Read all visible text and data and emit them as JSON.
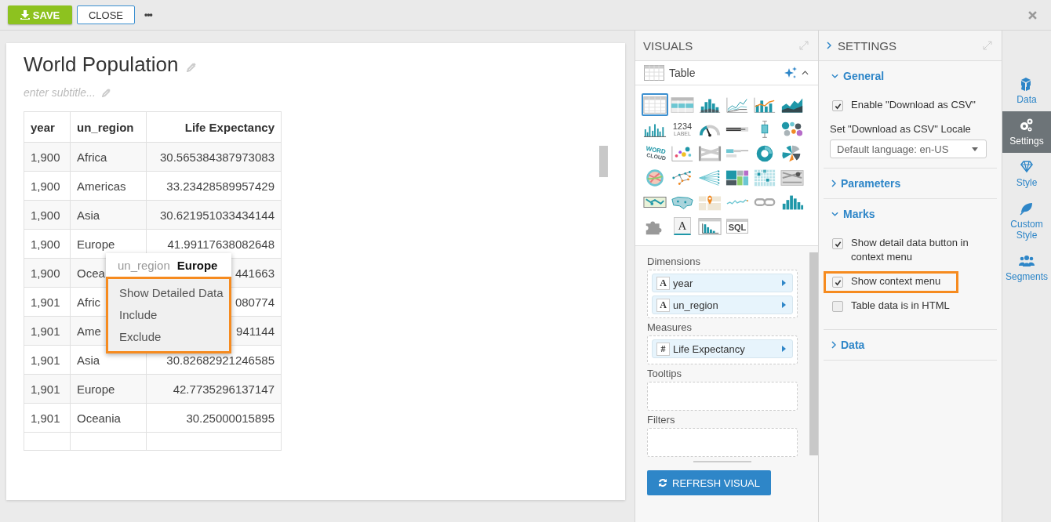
{
  "toolbar": {
    "save": "SAVE",
    "close": "CLOSE",
    "more": "•••"
  },
  "visual": {
    "title": "World Population",
    "subtitle_placeholder": "enter subtitle...",
    "table": {
      "columns": [
        "year",
        "un_region",
        "Life Expectancy"
      ],
      "rows": [
        [
          "1,900",
          "Africa",
          "30.565384387973083"
        ],
        [
          "1,900",
          "Americas",
          "33.23428589957429"
        ],
        [
          "1,900",
          "Asia",
          "30.621951033434144"
        ],
        [
          "1,900",
          "Europe",
          "41.99117638082648"
        ],
        [
          "1,900",
          "Ocea",
          "441663"
        ],
        [
          "1,901",
          "Afric",
          "080774"
        ],
        [
          "1,901",
          "Ame",
          "941144"
        ],
        [
          "1,901",
          "Asia",
          "30.82682921246585"
        ],
        [
          "1,901",
          "Europe",
          "42.7735296137147"
        ],
        [
          "1,901",
          "Oceania",
          "30.25000015895"
        ]
      ]
    },
    "context_menu": {
      "field": "un_region",
      "value": "Europe",
      "highlighted": true,
      "items": [
        "Show Detailed Data",
        "Include",
        "Exclude"
      ]
    }
  },
  "visuals_panel": {
    "title": "VISUALS",
    "current": "Table",
    "types": [
      {
        "kind": "table",
        "selected": true
      },
      {
        "kind": "crosstab",
        "selected": false
      },
      {
        "kind": "stacked-bars",
        "selected": false
      },
      {
        "kind": "lines",
        "selected": false
      },
      {
        "kind": "combo",
        "selected": false
      },
      {
        "kind": "areas",
        "selected": false
      },
      {
        "kind": "bars",
        "selected": false
      },
      {
        "kind": "kpi",
        "selected": false,
        "texts": [
          "1234",
          "LABEL"
        ]
      },
      {
        "kind": "gauge",
        "selected": false
      },
      {
        "kind": "bullet",
        "selected": false
      },
      {
        "kind": "boxplot",
        "selected": false
      },
      {
        "kind": "bubbles",
        "selected": false
      },
      {
        "kind": "wordcloud",
        "selected": false,
        "texts": [
          "WORD",
          "CLOUD"
        ]
      },
      {
        "kind": "scatter",
        "selected": false
      },
      {
        "kind": "sankey",
        "selected": false
      },
      {
        "kind": "funnel",
        "selected": false
      },
      {
        "kind": "donut",
        "selected": false
      },
      {
        "kind": "radial",
        "selected": false
      },
      {
        "kind": "chord",
        "selected": false
      },
      {
        "kind": "network",
        "selected": false
      },
      {
        "kind": "dendrogram",
        "selected": false
      },
      {
        "kind": "treemap",
        "selected": false
      },
      {
        "kind": "heatmap",
        "selected": false
      },
      {
        "kind": "corrflow",
        "selected": false
      },
      {
        "kind": "map",
        "selected": false
      },
      {
        "kind": "usmap",
        "selected": false
      },
      {
        "kind": "pinmap",
        "selected": false
      },
      {
        "kind": "sparkline",
        "selected": false
      },
      {
        "kind": "link",
        "selected": false
      },
      {
        "kind": "histogram",
        "selected": false
      },
      {
        "kind": "extension",
        "selected": false
      },
      {
        "kind": "richtext",
        "selected": false,
        "texts": [
          "A"
        ]
      },
      {
        "kind": "tablehist",
        "selected": false
      },
      {
        "kind": "sql",
        "selected": false,
        "texts": [
          "SQL"
        ]
      }
    ],
    "shelves": [
      {
        "label": "Dimensions",
        "fields": [
          {
            "badge": "A",
            "name": "year"
          },
          {
            "badge": "A",
            "name": "un_region"
          }
        ]
      },
      {
        "label": "Measures",
        "fields": [
          {
            "badge": "#",
            "name": "Life Expectancy"
          }
        ]
      },
      {
        "label": "Tooltips"
      },
      {
        "label": "Filters"
      }
    ],
    "refresh": "REFRESH VISUAL"
  },
  "settings_panel": {
    "title": "SETTINGS",
    "sections": [
      {
        "label": "General",
        "expanded": true,
        "items": [
          {
            "kind": "checkbox",
            "label": "Enable \"Download as CSV\"",
            "checked": true,
            "highlighted": false
          },
          {
            "kind": "select",
            "label": "Set \"Download as CSV\" Locale",
            "value": "Default language: en-US"
          }
        ]
      },
      {
        "label": "Parameters",
        "expanded": false
      },
      {
        "label": "Marks",
        "expanded": true,
        "items": [
          {
            "kind": "checkbox",
            "label": "Show detail data button in context menu",
            "checked": true,
            "highlighted": false
          },
          {
            "kind": "checkbox",
            "label": "Show context menu",
            "checked": true,
            "highlighted": true
          },
          {
            "kind": "checkbox",
            "label": "Table data is in HTML",
            "checked": false,
            "highlighted": false
          }
        ]
      },
      {
        "label": "Data",
        "expanded": false
      }
    ]
  },
  "side_nav": [
    {
      "label": "Data",
      "selected": false
    },
    {
      "label": "Settings",
      "selected": true
    },
    {
      "label": "Style",
      "selected": false
    },
    {
      "label": "Custom Style",
      "selected": false
    },
    {
      "label": "Segments",
      "selected": false
    }
  ]
}
